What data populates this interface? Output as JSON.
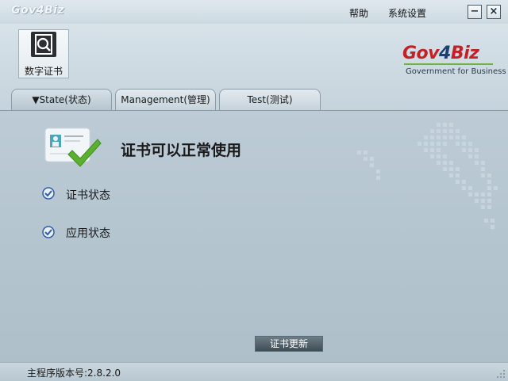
{
  "titlebar": {
    "app_logo": "Gov4Biz",
    "menu": {
      "help": "帮助",
      "settings": "系统设置"
    },
    "minimize_glyph": "−",
    "close_glyph": "×"
  },
  "header": {
    "module": {
      "label": "数字证书",
      "icon": "certificate-search-icon"
    },
    "brand": {
      "gov": "Gov",
      "four": "4",
      "biz": "Biz",
      "tagline": "Government for Business"
    }
  },
  "tabs": [
    {
      "label": "▼State(状态)",
      "active": true
    },
    {
      "label": "Management(管理)",
      "active": false
    },
    {
      "label": "Test(测试)",
      "active": false
    }
  ],
  "main": {
    "status_title": "证书可以正常使用",
    "checks": [
      {
        "label": "证书状态",
        "icon": "checkmark-icon"
      },
      {
        "label": "应用状态",
        "icon": "checkmark-icon"
      }
    ],
    "update_button": "证书更新"
  },
  "footer": {
    "version": "主程序版本号:2.8.2.0"
  },
  "colors": {
    "brand_red": "#c52026",
    "brand_navy": "#1f3f6e",
    "brand_green": "#6fb23f",
    "check_blue": "#2f5fa8"
  }
}
